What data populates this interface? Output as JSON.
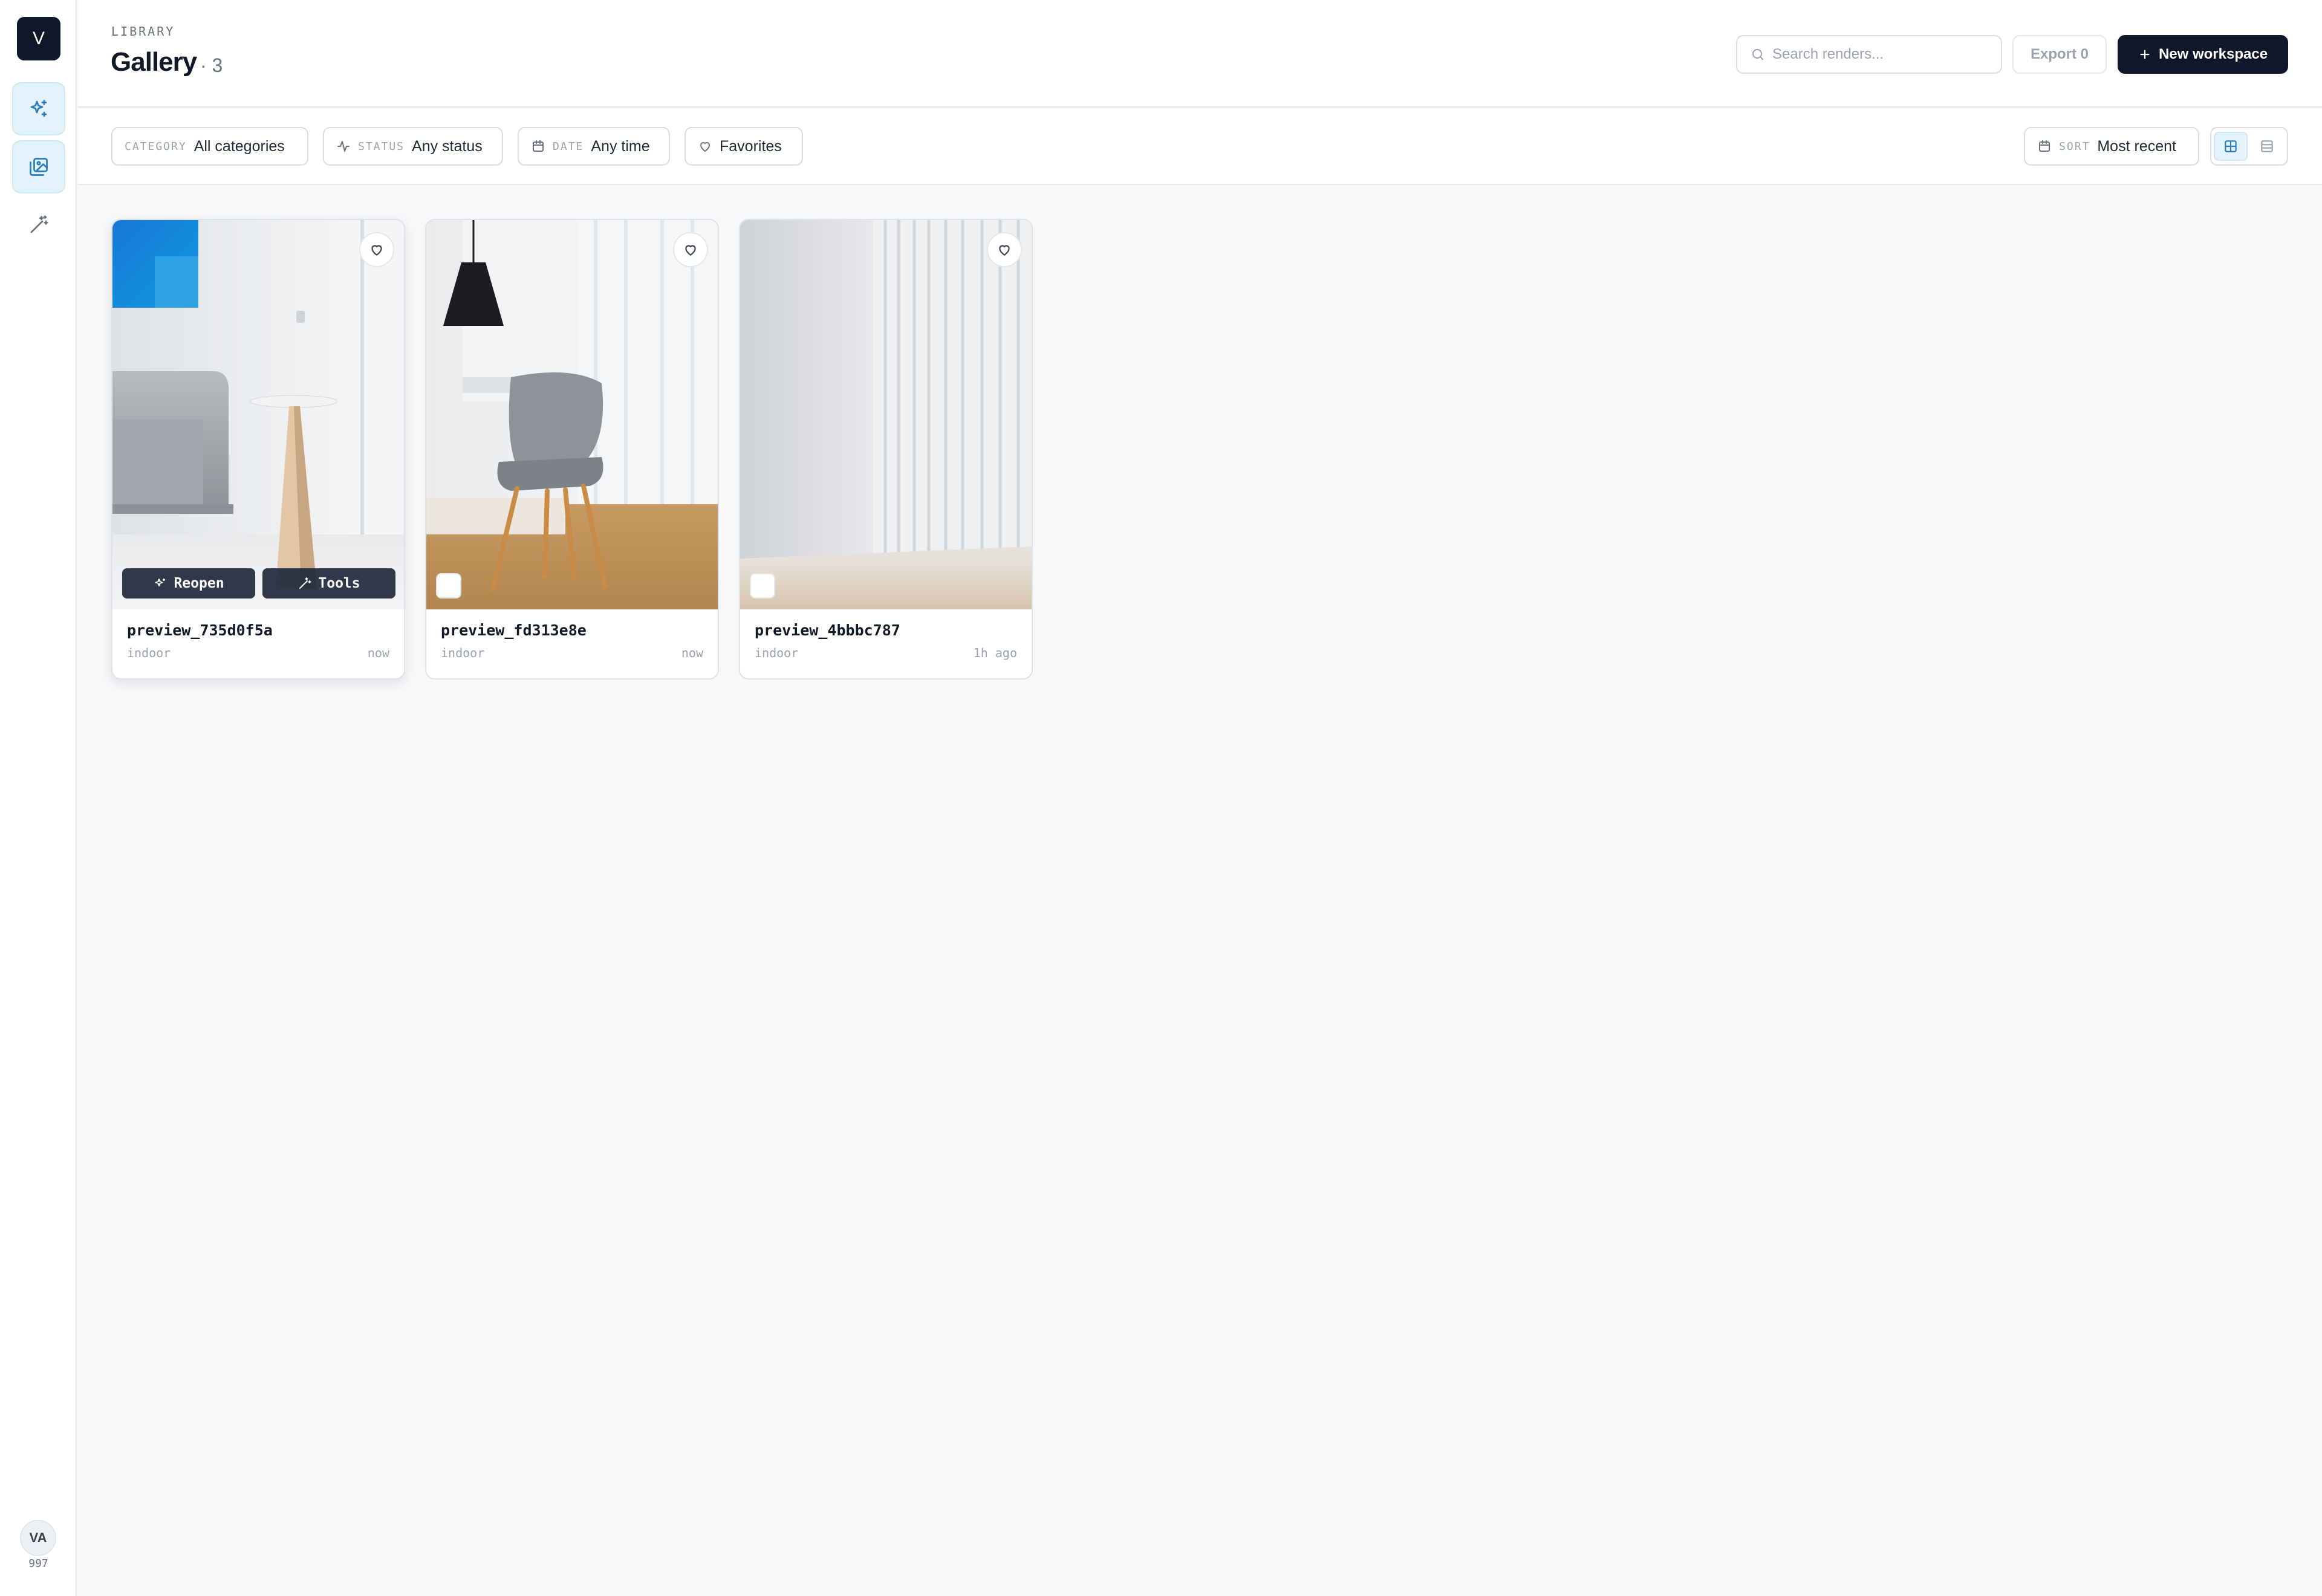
{
  "app": {
    "logo_letter": "V"
  },
  "sidebar": {
    "items": [
      {
        "icon": "sparkles-icon",
        "active": true
      },
      {
        "icon": "gallery-icon",
        "active": true
      },
      {
        "icon": "magic-wand-icon",
        "active": false
      }
    ],
    "user": {
      "initials": "VA",
      "credits": "997"
    }
  },
  "header": {
    "eyebrow": "LIBRARY",
    "title": "Gallery",
    "count": "· 3",
    "search_placeholder": "Search renders...",
    "export_label": "Export 0",
    "new_workspace_label": "New workspace"
  },
  "filters": {
    "category": {
      "label": "CATEGORY",
      "value": "All categories"
    },
    "status": {
      "label": "STATUS",
      "value": "Any status"
    },
    "date": {
      "label": "DATE",
      "value": "Any time"
    },
    "favorites": {
      "value": "Favorites"
    },
    "sort": {
      "label": "SORT",
      "value": "Most recent"
    },
    "view": "grid"
  },
  "cards": [
    {
      "name": "preview_735d0f5a",
      "category": "indoor",
      "time": "now",
      "favorite": false,
      "actions": {
        "reopen": "Reopen",
        "tools": "Tools"
      }
    },
    {
      "name": "preview_fd313e8e",
      "category": "indoor",
      "time": "now",
      "favorite": false
    },
    {
      "name": "preview_4bbbc787",
      "category": "indoor",
      "time": "1h ago",
      "favorite": false
    }
  ],
  "colors": {
    "accent": "#0f172a",
    "active_nav": "#e3f2fb",
    "active_icon": "#2b7bb9"
  }
}
